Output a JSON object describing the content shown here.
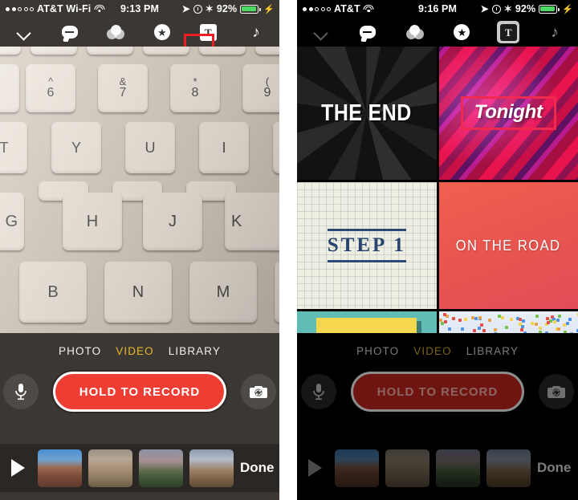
{
  "panels": {
    "left": {
      "status": {
        "signal_dots_filled": 2,
        "signal_dots_total": 5,
        "carrier": "AT&T Wi-Fi",
        "wifi_icon": "wifi-icon",
        "time": "9:13 PM",
        "location_icon": "location-arrow-icon",
        "alarm_icon": "alarm-clock-icon",
        "bluetooth_icon": "bluetooth-icon",
        "battery_pct": "92%",
        "battery_fill": 92,
        "charging_icon": "lightning-bolt-icon",
        "battery_color": "#4cd964"
      },
      "toolbar": {
        "collapse_icon": "chevron-down-icon",
        "items": [
          {
            "name": "comments-icon",
            "label": "Comments"
          },
          {
            "name": "filters-icon",
            "label": "Filters"
          },
          {
            "name": "star-icon",
            "label": "Effects"
          },
          {
            "name": "titles-icon",
            "label": "T"
          },
          {
            "name": "music-note-icon",
            "label": "Audio"
          }
        ],
        "annotation_color": "#ee1c23",
        "annotated_item": "titles-icon"
      },
      "viewfinder": {
        "subject": "keyboard",
        "keys": [
          "^ 6",
          "& 7",
          "* 8",
          "( 9",
          "T",
          "Y",
          "U",
          "I",
          "G",
          "H",
          "J",
          "K",
          "B",
          "N",
          "M"
        ]
      },
      "modes": [
        {
          "label": "PHOTO",
          "active": false
        },
        {
          "label": "VIDEO",
          "active": true
        },
        {
          "label": "LIBRARY",
          "active": false
        }
      ],
      "record": {
        "mic_icon": "microphone-icon",
        "button_label": "HOLD TO RECORD",
        "flip_icon": "camera-flip-icon",
        "button_color": "#ef3d33"
      },
      "filmstrip": {
        "play_icon": "play-icon",
        "clips": [
          "clip-1",
          "clip-2",
          "clip-3",
          "clip-4"
        ],
        "done_label": "Done"
      },
      "dimmed": false
    },
    "right": {
      "status": {
        "signal_dots_filled": 2,
        "signal_dots_total": 5,
        "carrier": "AT&T",
        "wifi_icon": "wifi-icon",
        "time": "9:16 PM",
        "location_icon": "location-arrow-icon",
        "alarm_icon": "alarm-clock-icon",
        "bluetooth_icon": "bluetooth-icon",
        "battery_pct": "92%",
        "battery_fill": 92,
        "charging_icon": "lightning-bolt-icon",
        "battery_color": "#4cd964"
      },
      "toolbar": {
        "collapse_icon": "chevron-down-icon",
        "items": [
          {
            "name": "comments-icon",
            "label": "Comments"
          },
          {
            "name": "filters-icon",
            "label": "Filters"
          },
          {
            "name": "star-icon",
            "label": "Effects"
          },
          {
            "name": "titles-icon",
            "label": "T"
          },
          {
            "name": "music-note-icon",
            "label": "Audio"
          }
        ],
        "selected_item": "titles-icon"
      },
      "title_cards": [
        {
          "id": "the-end",
          "label": "THE END",
          "style": "dark-rays"
        },
        {
          "id": "tonight",
          "label": "Tonight",
          "style": "magenta-stripes"
        },
        {
          "id": "step-1",
          "label": "STEP 1",
          "style": "graph-paper"
        },
        {
          "id": "on-the-road",
          "label": "ON THE ROAD",
          "style": "coral-gradient"
        },
        {
          "id": "teal-card",
          "label": "",
          "style": "teal-yellow-bar"
        },
        {
          "id": "confetti-card",
          "label": "",
          "style": "confetti"
        }
      ],
      "modes": [
        {
          "label": "PHOTO",
          "active": false
        },
        {
          "label": "VIDEO",
          "active": true
        },
        {
          "label": "LIBRARY",
          "active": false
        }
      ],
      "record": {
        "mic_icon": "microphone-icon",
        "button_label": "HOLD TO RECORD",
        "flip_icon": "camera-flip-icon",
        "button_color": "#6e1512"
      },
      "filmstrip": {
        "play_icon": "play-icon",
        "clips": [
          "clip-1",
          "clip-2",
          "clip-3",
          "clip-4"
        ],
        "done_label": "Done"
      },
      "dimmed": true
    }
  }
}
